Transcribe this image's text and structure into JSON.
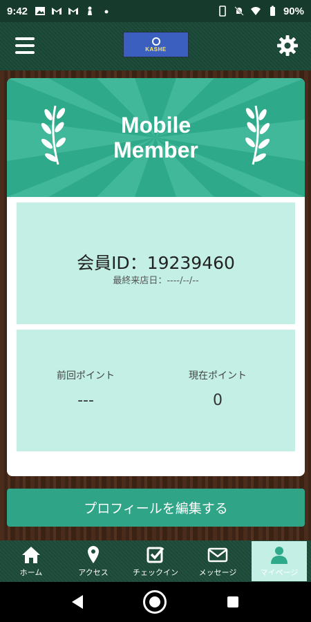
{
  "status_bar": {
    "time": "9:42",
    "battery": "90%"
  },
  "header": {
    "logo_text": "KASHE"
  },
  "banner": {
    "title_line1": "Mobile",
    "title_line2": "Member"
  },
  "member": {
    "id_label": "会員ID：",
    "id_value": "19239460",
    "last_visit": "最終来店日：----/--/--"
  },
  "points": {
    "previous_label": "前回ポイント",
    "previous_value": "---",
    "current_label": "現在ポイント",
    "current_value": "0"
  },
  "edit_button": "プロフィールを編集する",
  "tabs": [
    {
      "label": "ホーム",
      "icon": "home-icon"
    },
    {
      "label": "アクセス",
      "icon": "map-pin-icon"
    },
    {
      "label": "チェックイン",
      "icon": "checkbox-icon"
    },
    {
      "label": "メッセージ",
      "icon": "mail-icon"
    },
    {
      "label": "マイページ",
      "icon": "user-icon"
    }
  ],
  "colors": {
    "accent": "#2ea98a",
    "panel": "#c3efe4",
    "header": "#1f4f3c"
  }
}
